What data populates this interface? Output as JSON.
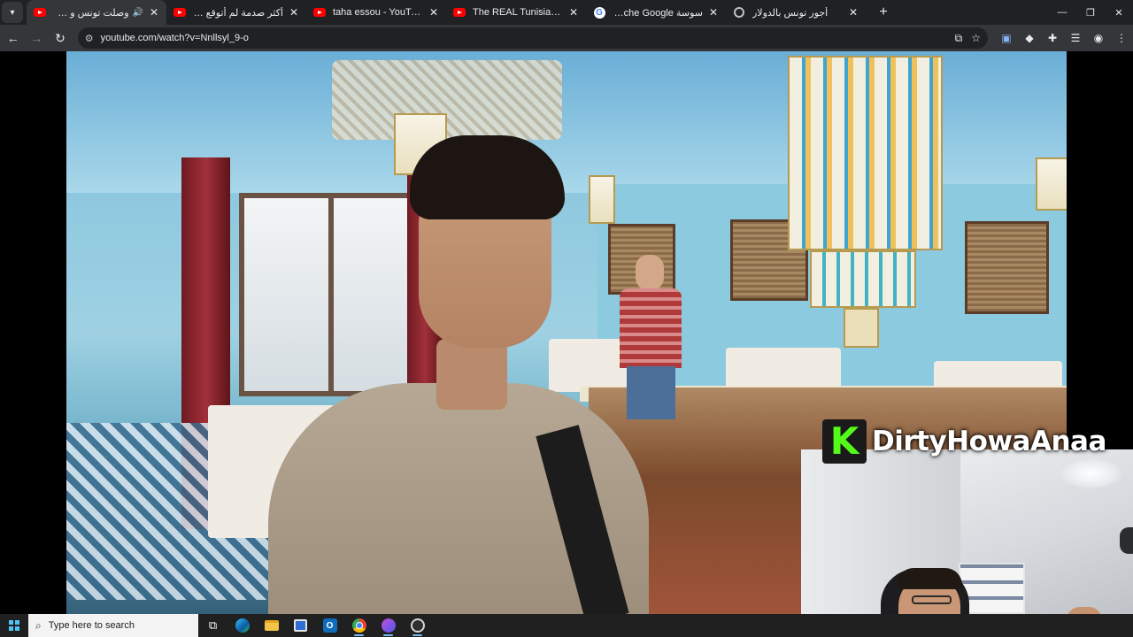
{
  "browser": {
    "tabs": [
      {
        "title": "وصلت تونس و ما توقعتش يه",
        "favicon": "youtube-icon",
        "active": true,
        "audio": true,
        "rtl": true
      },
      {
        "title": "أكثر صدمة لم أتوقع أن هذا في ال",
        "favicon": "youtube-icon",
        "active": false,
        "audio": false,
        "rtl": true
      },
      {
        "title": "taha essou - YouTube",
        "favicon": "youtube-icon",
        "active": false,
        "audio": false,
        "rtl": false
      },
      {
        "title": "The REAL Tunisia! SOUSSE, Wh",
        "favicon": "youtube-icon",
        "active": false,
        "audio": false,
        "rtl": false
      },
      {
        "title": "سوسة her - Recherche Google",
        "favicon": "google-icon",
        "active": false,
        "audio": false,
        "rtl": false
      },
      {
        "title": "أجور تونس بالدولار",
        "favicon": "globe-icon",
        "active": false,
        "audio": false,
        "rtl": true
      }
    ],
    "url": "youtube.com/watch?v=Nnllsyl_9-o",
    "new_tab_symbol": "+",
    "window_controls": {
      "minimize": "—",
      "restore": "❐",
      "close": "✕"
    }
  },
  "video": {
    "streamer_name": "DirtyHowaAnaa",
    "platform_logo_letter": "K",
    "platform_logo_color": "#53fc18"
  },
  "taskbar": {
    "search_placeholder": "Type here to search",
    "pinned_apps": [
      "task-view-icon",
      "edge-icon",
      "file-explorer-icon",
      "microsoft-store-icon",
      "outlook-icon",
      "chrome-icon",
      "discord-icon",
      "obs-icon"
    ],
    "accent_color": "#76b9ed"
  }
}
